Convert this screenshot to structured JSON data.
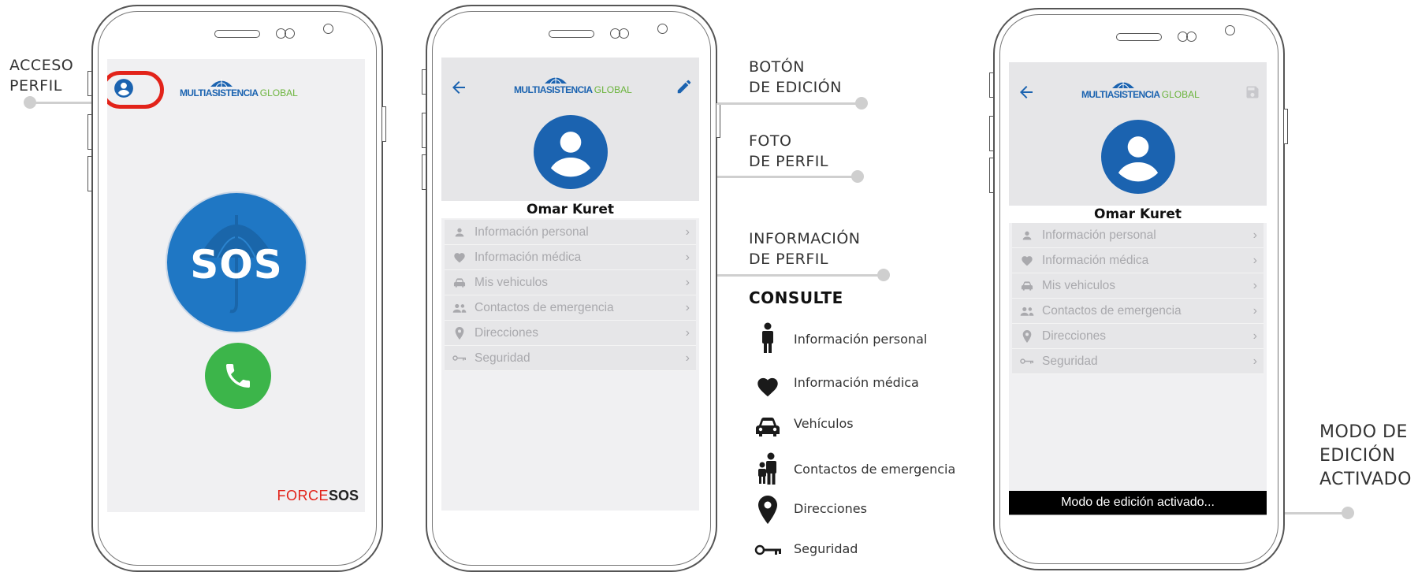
{
  "callouts": {
    "acceso_l1": "ACCESO",
    "acceso_l2": "PERFIL",
    "boton_l1": "BOTÓN",
    "boton_l2": "DE EDICIÓN",
    "foto_l1": "FOTO",
    "foto_l2": "DE PERFIL",
    "info_l1": "INFORMACIÓN",
    "info_l2": "DE PERFIL",
    "modo_l1": "MODO DE",
    "modo_l2": "EDICIÓN",
    "modo_l3": "ACTIVADO"
  },
  "brand": {
    "multi": "MULTIASISTENCIA",
    "global": "GLOBAL",
    "blue": "#1b63b0",
    "green": "#6ab33b"
  },
  "sos": {
    "label": "SOS",
    "color": "#1f77c4"
  },
  "call": {
    "color": "#3cb54a"
  },
  "forcesos": {
    "force": "FORCE",
    "sos": "SOS",
    "red": "#e2231a"
  },
  "profile": {
    "name": "Omar Kuret",
    "menu": [
      {
        "label": "Información personal",
        "icon": "person-icon"
      },
      {
        "label": "Información médica",
        "icon": "heart-icon"
      },
      {
        "label": "Mis vehiculos",
        "icon": "car-icon"
      },
      {
        "label": "Contactos de emergencia",
        "icon": "people-icon"
      },
      {
        "label": "Direcciones",
        "icon": "location-pin-icon"
      },
      {
        "label": "Seguridad",
        "icon": "key-icon"
      }
    ]
  },
  "toast": "Modo de edición activado...",
  "legend": {
    "title": "CONSULTE",
    "items": [
      {
        "label": "Información personal",
        "icon": "person-standing-icon"
      },
      {
        "label": "Información médica",
        "icon": "heart-icon"
      },
      {
        "label": "Vehículos",
        "icon": "car-icon"
      },
      {
        "label": "Contactos de emergencia",
        "icon": "family-icon"
      },
      {
        "label": "Direcciones",
        "icon": "location-pin-icon"
      },
      {
        "label": "Seguridad",
        "icon": "key-icon"
      }
    ]
  },
  "colors": {
    "highlight_ring": "#e2231a",
    "accent_blue": "#1b63b0",
    "toast_bg": "#000000"
  }
}
